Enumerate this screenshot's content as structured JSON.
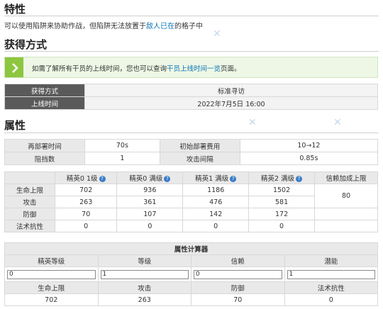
{
  "traits": {
    "heading": "特性",
    "text_before": "可以使用陷阱来协助作战，但陷阱无法放置于",
    "highlight": "敌人已在",
    "text_after": "的格子中"
  },
  "acquire": {
    "heading": "获得方式",
    "notice_before": "如需了解所有干员的上线时间，您也可以查询",
    "notice_link": "干员上线时间一览",
    "notice_after": "页面。",
    "rows": [
      {
        "key": "获得方式",
        "value": "标准寻访"
      },
      {
        "key": "上线时间",
        "value": "2022年7月5日 16:00"
      }
    ]
  },
  "attributes": {
    "heading": "属性",
    "basic": [
      {
        "k1": "再部署时间",
        "v1": "70s",
        "k2": "初始部署费用",
        "v2": "10→12"
      },
      {
        "k1": "阻挡数",
        "v1": "1",
        "k2": "攻击间隔",
        "v2": "0.85s"
      }
    ],
    "stats_headers": [
      "精英0 1级",
      "精英0 满级",
      "精英1 满级",
      "精英2 满级",
      "信赖加成上限"
    ],
    "stats_rows": [
      {
        "label": "生命上限",
        "values": [
          "702",
          "936",
          "1186",
          "1502"
        ],
        "trust": "80"
      },
      {
        "label": "攻击",
        "values": [
          "263",
          "361",
          "476",
          "581"
        ],
        "trust": ""
      },
      {
        "label": "防御",
        "values": [
          "70",
          "107",
          "142",
          "172"
        ],
        "trust": ""
      },
      {
        "label": "法术抗性",
        "values": [
          "0",
          "0",
          "0",
          "0"
        ],
        "trust": ""
      }
    ]
  },
  "calculator": {
    "title": "属性计算器",
    "input_labels": [
      "精英等级",
      "等级",
      "信赖",
      "潜能"
    ],
    "input_values": [
      "0",
      "1",
      "0",
      "1"
    ],
    "result_labels": [
      "生命上限",
      "攻击",
      "防御",
      "法术抗性"
    ],
    "result_values": [
      "702",
      "263",
      "70",
      "0"
    ]
  },
  "colors": {
    "notice_bar": "#8dc63f",
    "link": "#0a76b8",
    "dark_header": "#5a5a5a",
    "help_icon": "#3b7ec9"
  }
}
